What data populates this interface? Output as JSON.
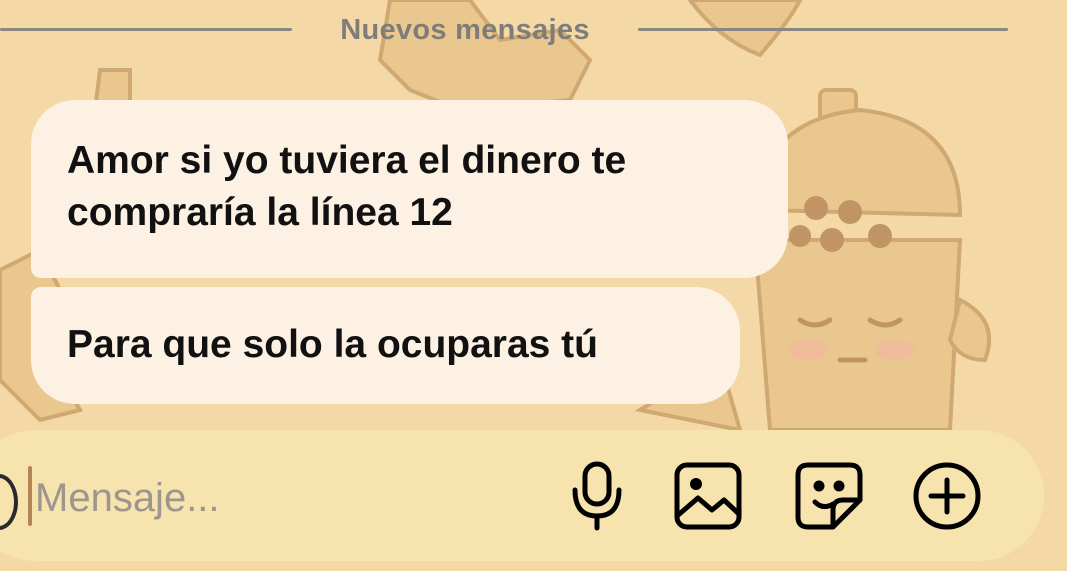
{
  "divider": {
    "label": "Nuevos mensajes"
  },
  "messages": [
    {
      "text": "Amor si yo tuviera el dinero te compraría la línea 12"
    },
    {
      "text": "Para que solo la ocuparas tú"
    }
  ],
  "composer": {
    "placeholder": "Mensaje...",
    "value": "",
    "tools": [
      "microphone-icon",
      "image-icon",
      "sticker-icon",
      "plus-icon"
    ]
  },
  "colors": {
    "wallpaper": "#f4d9a6",
    "bubble": "#fcf1e3",
    "composer": "#f7e3ae",
    "divider": "#8a8680"
  }
}
